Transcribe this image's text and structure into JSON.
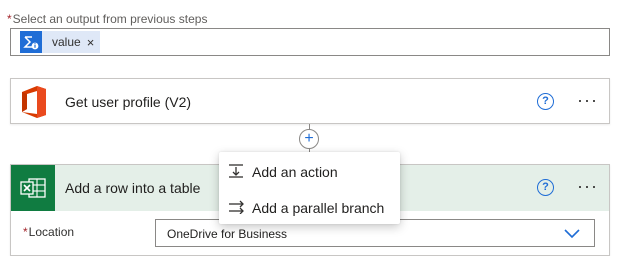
{
  "output_selector": {
    "required_mark": "*",
    "label": "Select an output from previous steps",
    "token": {
      "label": "value",
      "remove_glyph": "×",
      "icon": "expression-variable-icon"
    }
  },
  "card_profile": {
    "title": "Get user profile (V2)",
    "logo": "office-365-logo",
    "help_glyph": "?",
    "more_glyph": "···"
  },
  "add_step": {
    "glyph": "+"
  },
  "card_excel": {
    "title": "Add a row into a table",
    "logo": "excel-logo",
    "help_glyph": "?",
    "more_glyph": "···",
    "location": {
      "required_mark": "*",
      "label": "Location",
      "value": "OneDrive for Business"
    }
  },
  "insert_menu": {
    "items": [
      {
        "label": "Add an action",
        "icon": "insert-action-icon"
      },
      {
        "label": "Add a parallel branch",
        "icon": "parallel-branch-icon"
      }
    ]
  },
  "colors": {
    "accent": "#1f6dd6",
    "excel_green": "#107c41",
    "excel_header": "#e4efe8",
    "required": "#a4262c"
  }
}
